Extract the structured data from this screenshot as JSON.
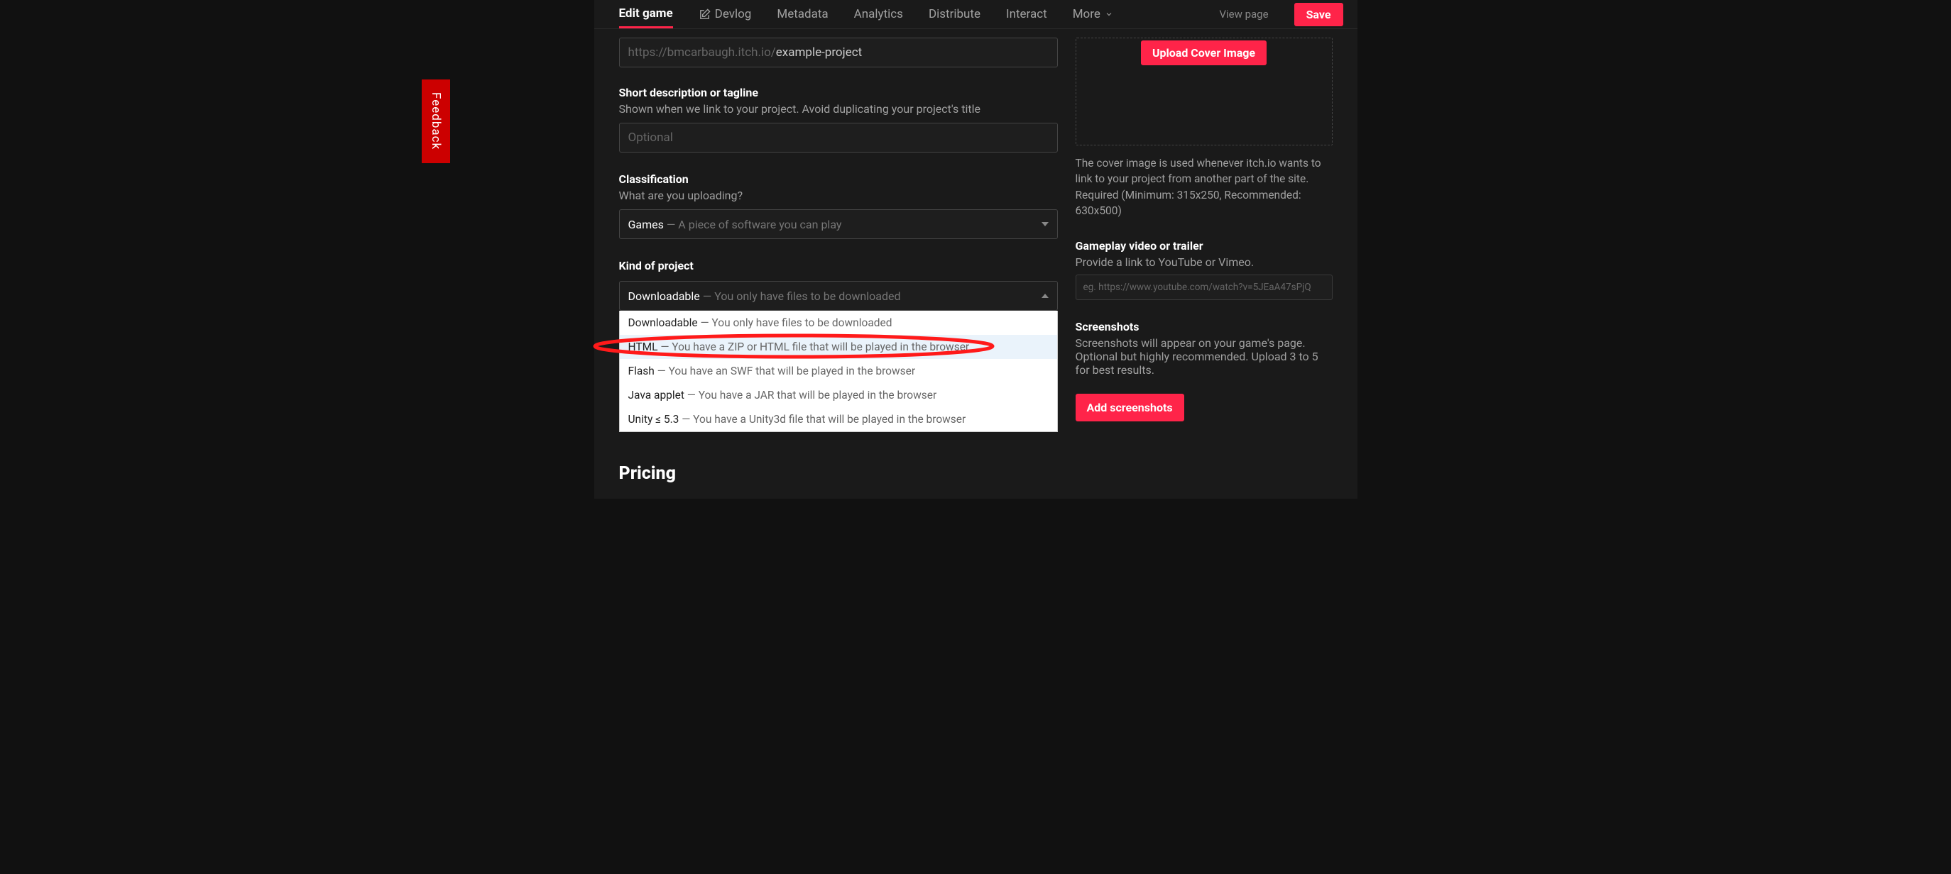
{
  "feedback": "Feedback",
  "nav": {
    "tabs": [
      "Edit game",
      "Devlog",
      "Metadata",
      "Analytics",
      "Distribute",
      "Interact",
      "More"
    ],
    "viewpage": "View page",
    "save": "Save"
  },
  "url": {
    "prefix": "https://bmcarbaugh.itch.io/",
    "value": "example-project"
  },
  "desc": {
    "label": "Short description or tagline",
    "help": "Shown when we link to your project. Avoid duplicating your project's title",
    "placeholder": "Optional"
  },
  "classification": {
    "label": "Classification",
    "help": "What are you uploading?",
    "selected": {
      "main": "Games",
      "sub": " — A piece of software you can play"
    }
  },
  "kind": {
    "label": "Kind of project",
    "selected": {
      "main": "Downloadable",
      "sub": " — You only have files to be downloaded"
    },
    "options": [
      {
        "main": "Downloadable",
        "sub": " — You only have files to be downloaded"
      },
      {
        "main": "HTML",
        "sub": " — You have a ZIP or HTML file that will be played in the browser"
      },
      {
        "main": "Flash",
        "sub": " — You have an SWF that will be played in the browser"
      },
      {
        "main": "Java applet",
        "sub": " — You have a JAR that will be played in the browser"
      },
      {
        "main": "Unity ≤ 5.3",
        "sub": " — You have a Unity3d file that will be played in the browser"
      }
    ]
  },
  "pricing": "Pricing",
  "cover": {
    "btn": "Upload Cover Image",
    "desc": "The cover image is used whenever itch.io wants to link to your project from another part of the site. Required (Minimum: 315x250, Recommended: 630x500)"
  },
  "video": {
    "label": "Gameplay video or trailer",
    "help": "Provide a link to YouTube or Vimeo.",
    "placeholder": "eg. https://www.youtube.com/watch?v=5JEaA47sPjQ"
  },
  "shots": {
    "label": "Screenshots",
    "help": "Screenshots will appear on your game's page. Optional but highly recommended. Upload 3 to 5 for best results.",
    "btn": "Add screenshots"
  }
}
